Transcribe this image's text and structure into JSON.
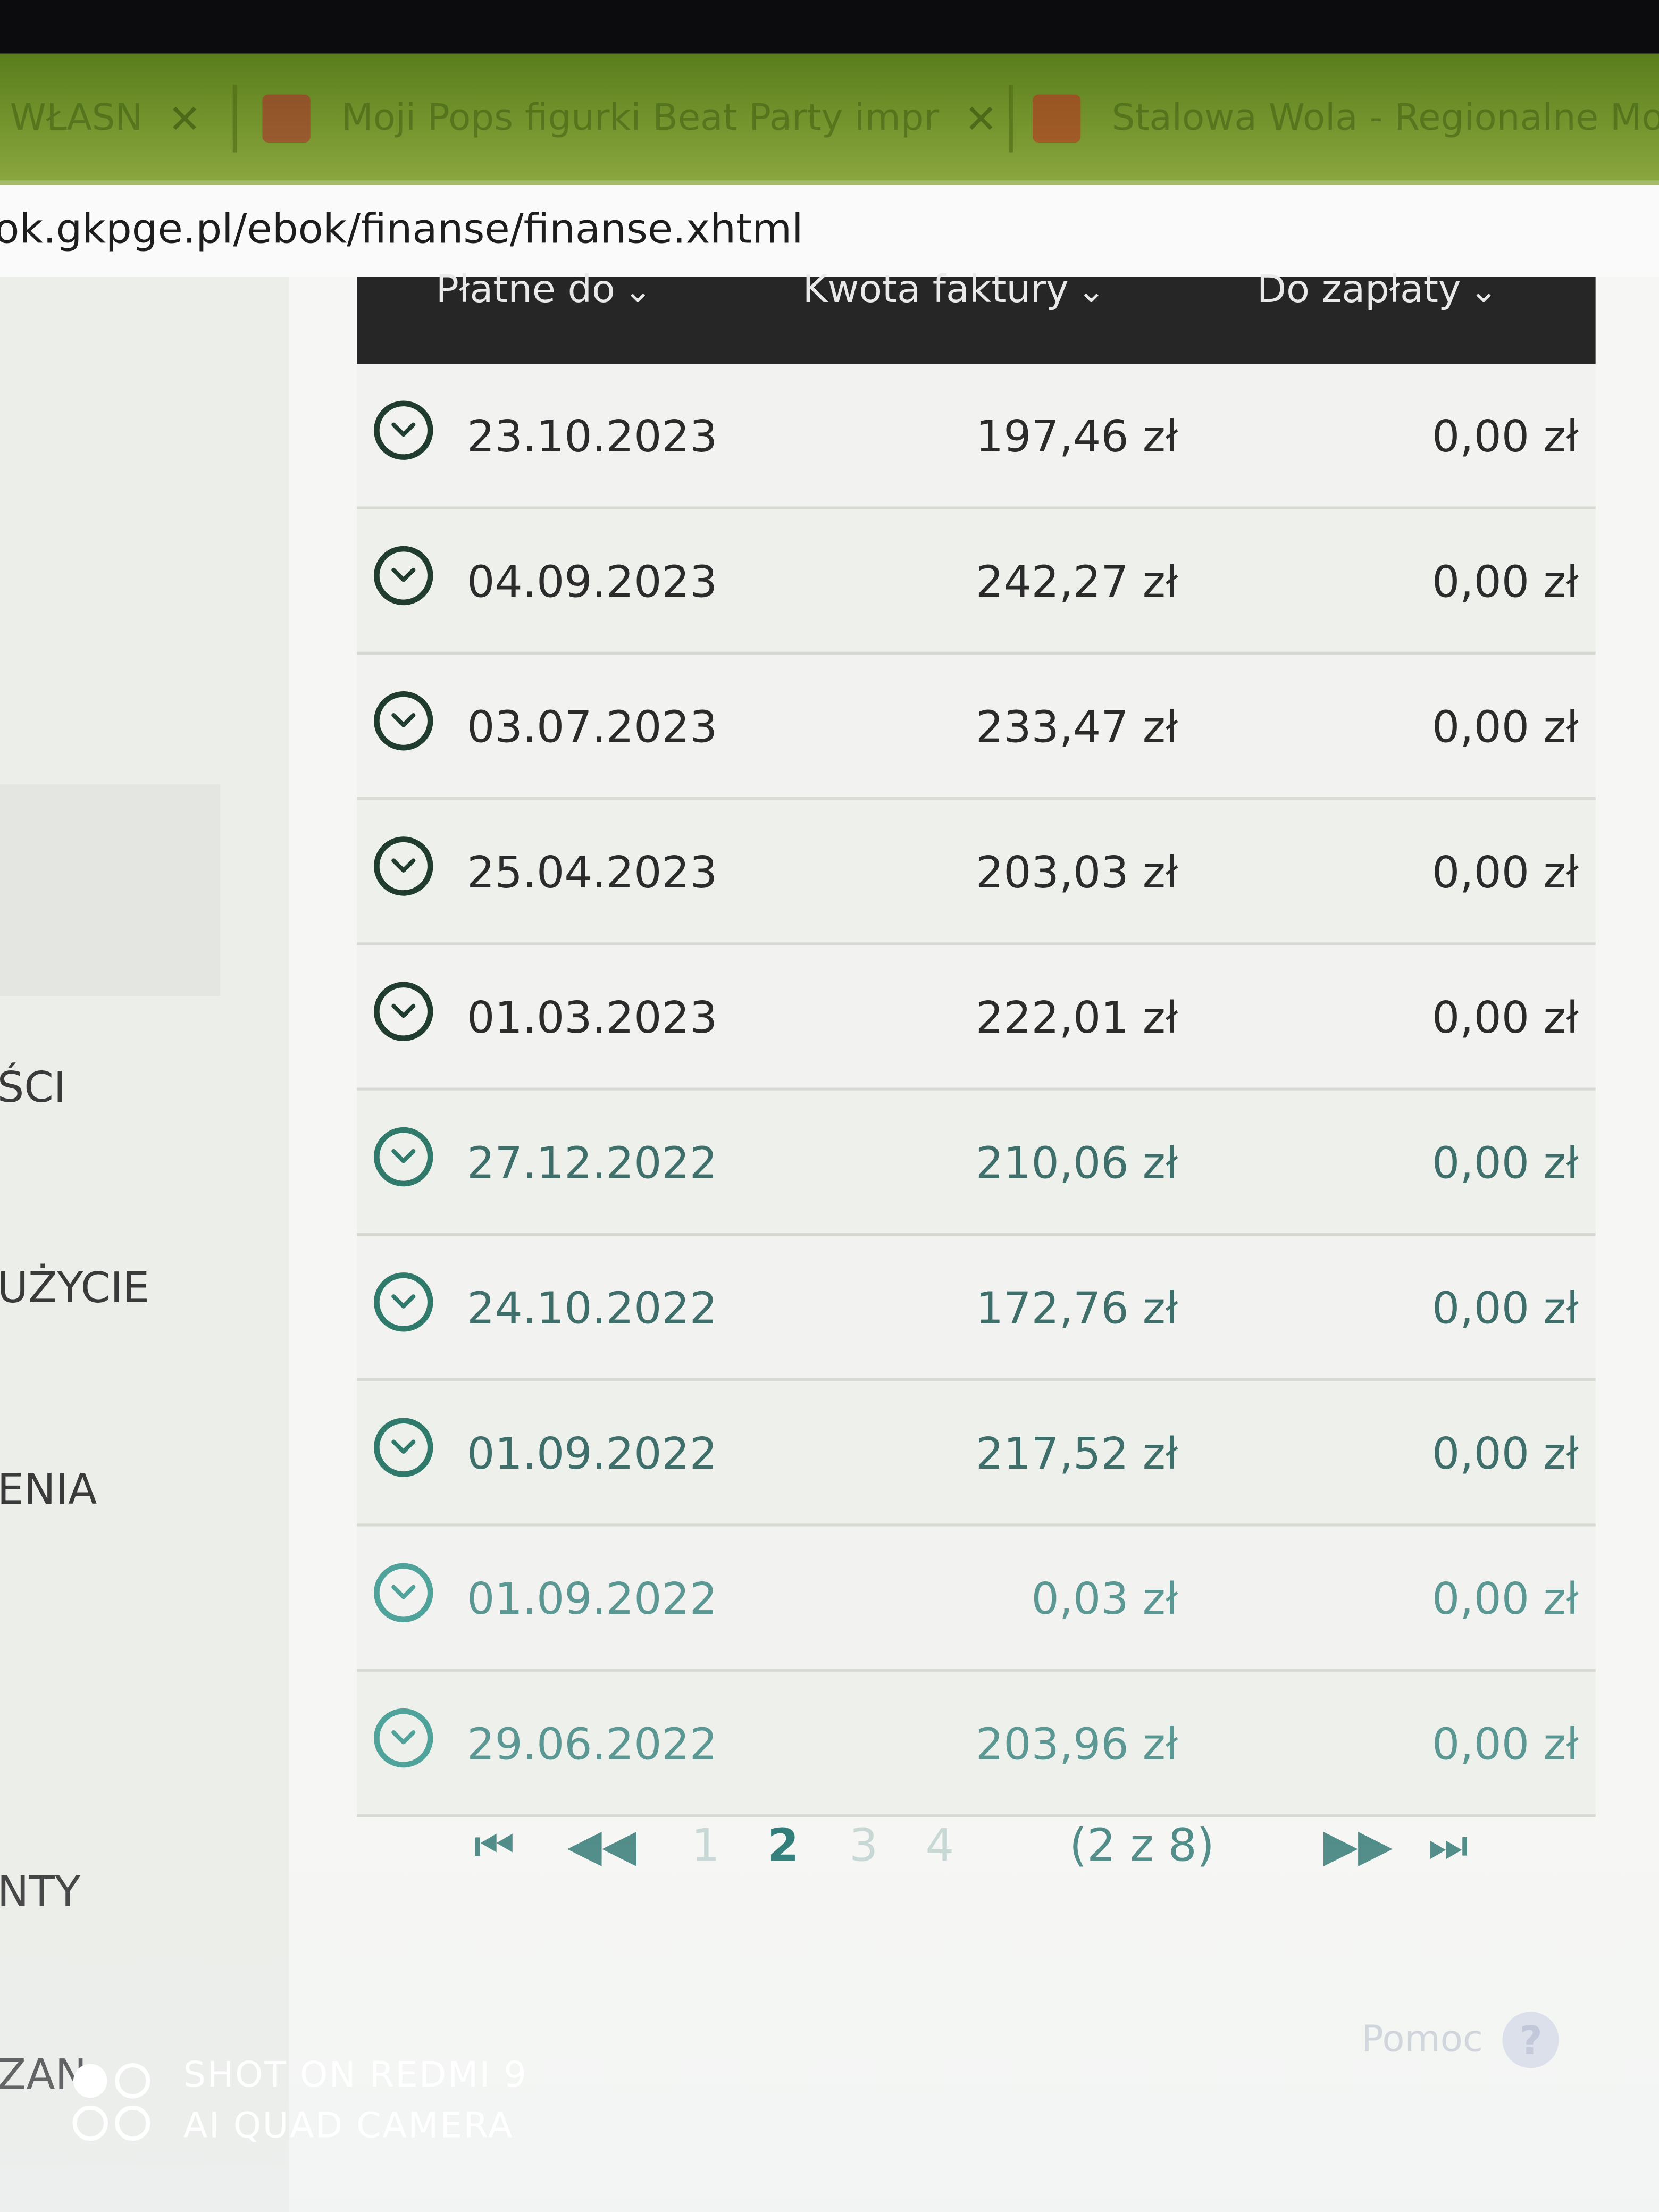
{
  "browser": {
    "tabs": [
      {
        "title": "/ WŁASN"
      },
      {
        "title": "Moji Pops figurki Beat Party impr"
      },
      {
        "title": "Stalowa Wola - Regionalne Mol"
      }
    ],
    "url": "ok.gkpge.pl/ebok/finanse/finanse.xhtml"
  },
  "sidebar": {
    "items": [
      "ŚCI",
      "UŻYCIE",
      "ENIA",
      "NTY",
      "ZAN"
    ]
  },
  "table": {
    "headers": {
      "due_date": "Płatne do",
      "invoice_amount": "Kwota faktury",
      "to_pay": "Do zapłaty"
    },
    "rows": [
      {
        "date": "23.10.2023",
        "amount": "197,46 zł",
        "to_pay": "0,00 zł"
      },
      {
        "date": "04.09.2023",
        "amount": "242,27 zł",
        "to_pay": "0,00 zł"
      },
      {
        "date": "03.07.2023",
        "amount": "233,47 zł",
        "to_pay": "0,00 zł"
      },
      {
        "date": "25.04.2023",
        "amount": "203,03 zł",
        "to_pay": "0,00 zł"
      },
      {
        "date": "01.03.2023",
        "amount": "222,01 zł",
        "to_pay": "0,00 zł"
      },
      {
        "date": "27.12.2022",
        "amount": "210,06 zł",
        "to_pay": "0,00 zł"
      },
      {
        "date": "24.10.2022",
        "amount": "172,76 zł",
        "to_pay": "0,00 zł"
      },
      {
        "date": "01.09.2022",
        "amount": "217,52 zł",
        "to_pay": "0,00 zł"
      },
      {
        "date": "01.09.2022",
        "amount": "0,03 zł",
        "to_pay": "0,00 zł"
      },
      {
        "date": "29.06.2022",
        "amount": "203,96 zł",
        "to_pay": "0,00 zł"
      }
    ]
  },
  "pagination": {
    "first": "⏮",
    "prev": "◀◀",
    "pages": [
      "1",
      "2",
      "3",
      "4"
    ],
    "current_page": "2",
    "summary": "(2 z 8)",
    "next": "▶▶",
    "last": "⏭"
  },
  "help": {
    "label": "Pomoc",
    "icon": "?"
  },
  "watermark": {
    "line1": "SHOT ON REDMI 9",
    "line2": "AI QUAD CAMERA"
  },
  "colors": {
    "tab_bar": "#76962f",
    "header_bg": "#262626",
    "row_icon": "#1f3c2f",
    "pager": "#4d8a86"
  }
}
